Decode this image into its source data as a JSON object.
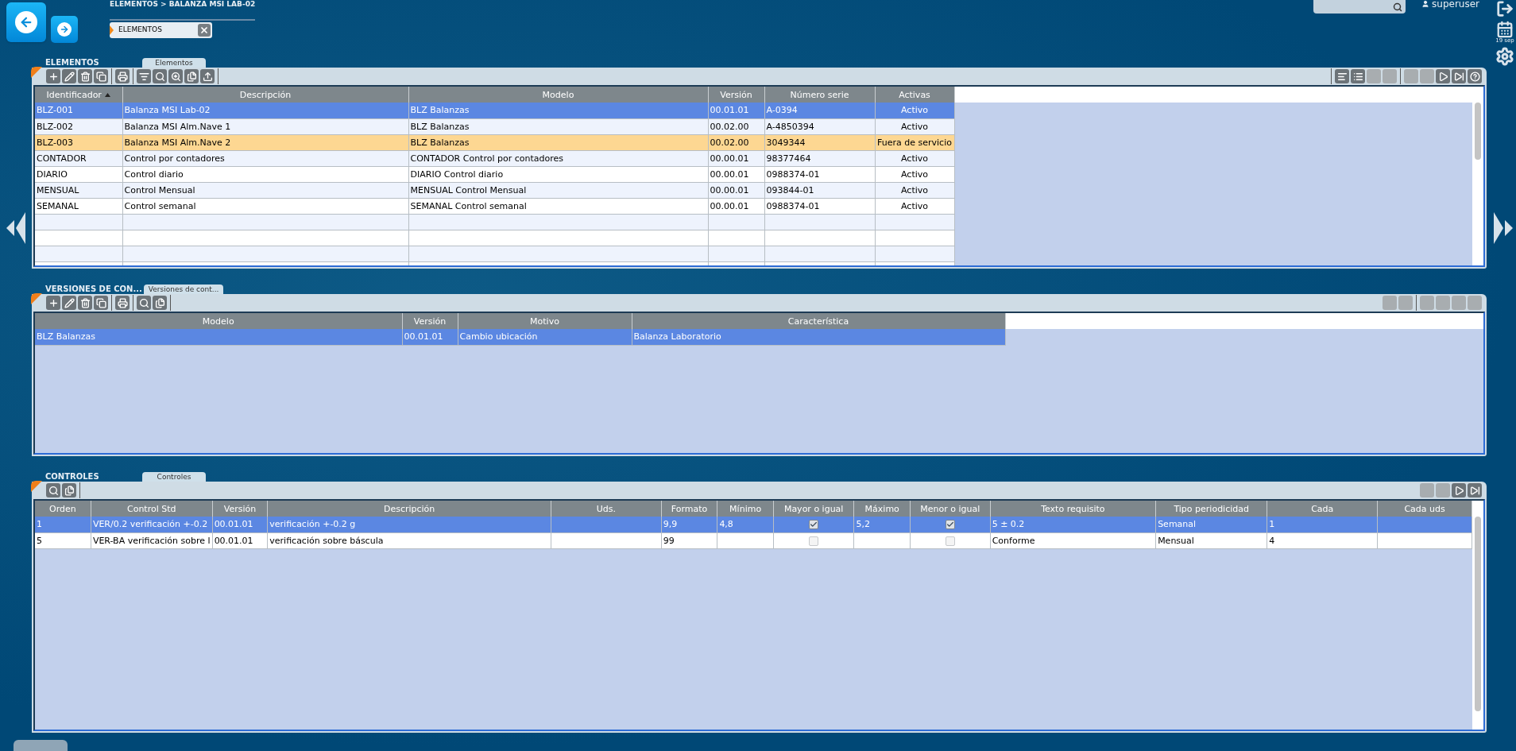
{
  "breadcrumb": "ELEMENTOS > BALANZA MSI LAB-02",
  "user": "superuser",
  "date": "19 sep",
  "open_tabs": [
    {
      "label": "ELEMENTOS",
      "selected": true
    }
  ],
  "elementos": {
    "title": "ELEMENTOS",
    "tab": "Elementos",
    "columns": [
      {
        "label": "Identificador",
        "sorted": true
      },
      {
        "label": "Descripción",
        "sorted": false
      },
      {
        "label": "Modelo",
        "sorted": false
      },
      {
        "label": "Versión",
        "sorted": false
      },
      {
        "label": "Número serie",
        "sorted": false
      },
      {
        "label": "Activas",
        "sorted": false
      }
    ],
    "rows": [
      {
        "cells": [
          "BLZ-001",
          "Balanza MSI Lab-02",
          "BLZ Balanzas",
          "00.01.01",
          "A-0394",
          "Activo"
        ],
        "selected": true,
        "warning": false
      },
      {
        "cells": [
          "BLZ-002",
          "Balanza MSI Alm.Nave 1",
          "BLZ Balanzas",
          "00.02.00",
          "A-4850394",
          "Activo"
        ],
        "selected": false,
        "warning": false
      },
      {
        "cells": [
          "BLZ-003",
          "Balanza MSI Alm.Nave 2",
          "BLZ Balanzas",
          "00.02.00",
          "3049344",
          "Fuera de servicio"
        ],
        "selected": false,
        "warning": true
      },
      {
        "cells": [
          "CONTADOR",
          "Control por contadores",
          "CONTADOR Control por contadores",
          "00.00.01",
          "98377464",
          "Activo"
        ],
        "selected": false,
        "warning": false
      },
      {
        "cells": [
          "DIARIO",
          "Control diario",
          "DIARIO Control diario",
          "00.00.01",
          "0988374-01",
          "Activo"
        ],
        "selected": false,
        "warning": false
      },
      {
        "cells": [
          "MENSUAL",
          "Control Mensual",
          "MENSUAL Control Mensual",
          "00.00.01",
          "093844-01",
          "Activo"
        ],
        "selected": false,
        "warning": false
      },
      {
        "cells": [
          "SEMANAL",
          "Control semanal",
          "SEMANAL Control semanal",
          "00.00.01",
          "0988374-01",
          "Activo"
        ],
        "selected": false,
        "warning": false
      }
    ]
  },
  "versiones": {
    "title": "VERSIONES DE CON...",
    "tab": "Versiones de cont...",
    "columns": [
      {
        "label": "Modelo",
        "sorted": false
      },
      {
        "label": "Versión",
        "sorted": false
      },
      {
        "label": "Motivo",
        "sorted": false
      },
      {
        "label": "Característica",
        "sorted": false
      }
    ],
    "rows": [
      {
        "cells": [
          "BLZ Balanzas",
          "00.01.01",
          "Cambio ubicación",
          "Balanza Laboratorio"
        ],
        "selected": true
      }
    ]
  },
  "controles": {
    "title": "CONTROLES",
    "tab": "Controles",
    "columns": [
      {
        "label": "Orden",
        "kind": "text"
      },
      {
        "label": "Control Std",
        "kind": "text"
      },
      {
        "label": "Versión",
        "kind": "text"
      },
      {
        "label": "Descripción",
        "kind": "text"
      },
      {
        "label": "Uds.",
        "kind": "text"
      },
      {
        "label": "Formato",
        "kind": "text"
      },
      {
        "label": "Mínimo",
        "kind": "text"
      },
      {
        "label": "Mayor o igual",
        "kind": "check"
      },
      {
        "label": "Máximo",
        "kind": "text"
      },
      {
        "label": "Menor o igual",
        "kind": "check"
      },
      {
        "label": "Texto requisito",
        "kind": "text"
      },
      {
        "label": "Tipo periodicidad",
        "kind": "text"
      },
      {
        "label": "Cada",
        "kind": "text"
      },
      {
        "label": "Cada uds",
        "kind": "text"
      }
    ],
    "rows": [
      {
        "cells": [
          "1",
          "VER/0.2 verificación +-0.2",
          "00.01.01",
          "verificación +-0.2 g",
          null,
          "9,9",
          "4,8",
          {
            "checked": true
          },
          "5,2",
          {
            "checked": true
          },
          "5 ± 0.2",
          "Semanal",
          "1",
          null
        ],
        "selected": true
      },
      {
        "cells": [
          "5",
          "VER-BA verificación sobre l",
          "00.01.01",
          "verificación sobre báscula",
          null,
          "99",
          null,
          {
            "checked": false
          },
          null,
          {
            "checked": false
          },
          "Conforme",
          "Mensual",
          "4",
          null
        ],
        "selected": false
      }
    ]
  }
}
